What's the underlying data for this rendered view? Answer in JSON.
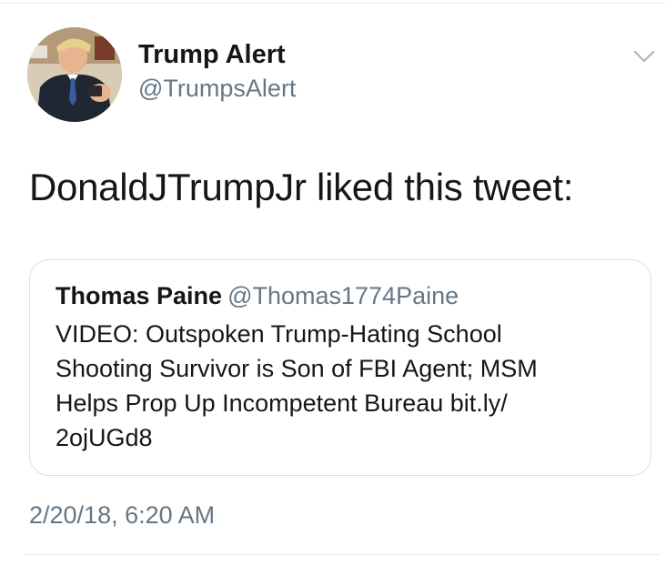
{
  "tweet": {
    "author_name": "Trump Alert",
    "author_handle": "@TrumpsAlert",
    "text": "DonaldJTrumpJr liked this tweet:",
    "timestamp": "2/20/18, 6:20 AM"
  },
  "quoted_tweet": {
    "author_name": "Thomas Paine",
    "author_handle": "@Thomas1774Paine",
    "text": "VIDEO: Outspoken Trump-Hating School\nShooting Survivor is Son of FBI Agent; MSM\nHelps Prop Up Incompetent Bureau bit.ly/\n2ojUGd8"
  },
  "icons": {
    "caret": "chevron-down-icon"
  },
  "colors": {
    "text": "#14171a",
    "secondary_text": "#657786",
    "border": "#d8dfe4"
  }
}
